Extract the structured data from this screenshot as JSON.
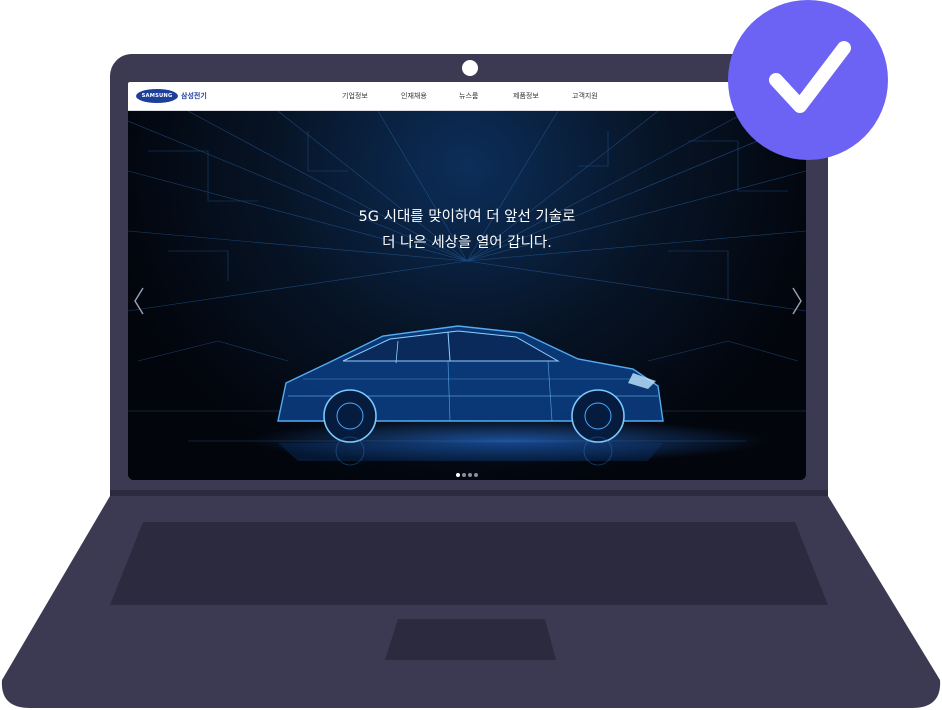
{
  "site": {
    "logo_text": "SAMSUNG",
    "logo_sub": "삼성전기"
  },
  "nav": {
    "items": [
      {
        "label": "기업정보"
      },
      {
        "label": "인재채용"
      },
      {
        "label": "뉴스룸"
      },
      {
        "label": "제품정보"
      },
      {
        "label": "고객지원"
      }
    ]
  },
  "hero": {
    "headline_line1": "5G 시대를 맞이하여 더 앞선 기술로",
    "headline_line2": "더 나은 세상을 열어 갑니다.",
    "slide_count": 4,
    "active_slide": 1
  },
  "badge": {
    "icon": "checkmark-icon",
    "color": "#6c63f5"
  },
  "colors": {
    "laptop_body": "#3b3a52",
    "laptop_dark": "#2b2a3f",
    "brand_blue": "#1d3f9c"
  }
}
